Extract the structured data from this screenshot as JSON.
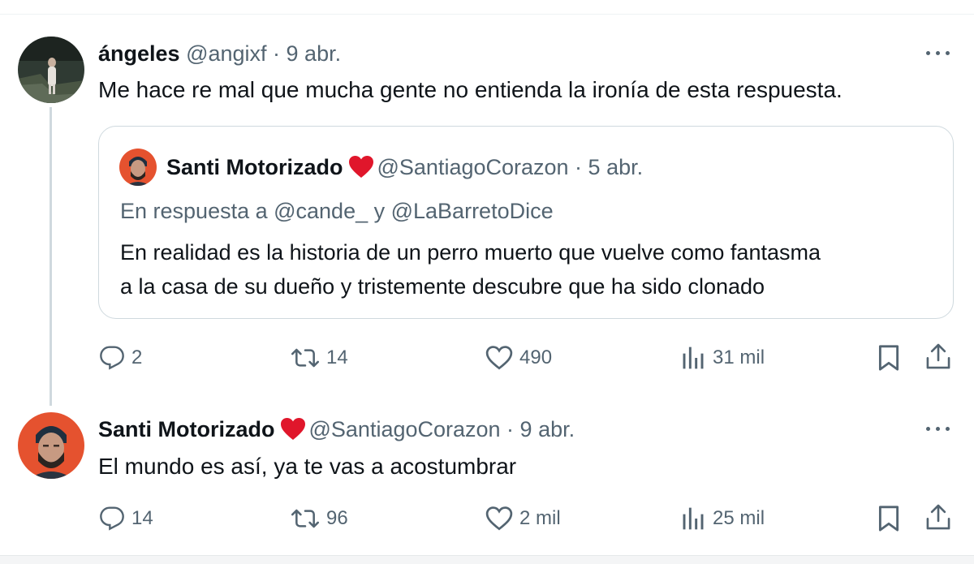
{
  "tweet1": {
    "name": "ángeles",
    "handle": "@angixf · 9 abr.",
    "text": "Me hace re mal que mucha gente no entienda la ironía de esta respuesta.",
    "quote": {
      "name": "Santi Motorizado",
      "handle": "@SantiagoCorazon · 5 abr.",
      "reply_to": "En respuesta a @cande_ y @LaBarretoDice",
      "line1": "En realidad es la historia de un perro muerto que vuelve como fantasma",
      "line2": "a la casa de su dueño y tristemente descubre que ha sido clonado"
    },
    "actions": {
      "replies": "2",
      "reposts": "14",
      "likes": "490",
      "views": "31 mil"
    }
  },
  "tweet2": {
    "name": "Santi Motorizado",
    "handle": "@SantiagoCorazon · 9 abr.",
    "text": "El mundo es así, ya te vas a acostumbrar",
    "actions": {
      "replies": "14",
      "reposts": "96",
      "likes": "2 mil",
      "views": "25 mil"
    }
  },
  "icons": {
    "reply": "speech-bubble-icon",
    "repost": "repost-arrows-icon",
    "like": "heart-outline-icon",
    "views": "bar-chart-icon",
    "bookmark": "bookmark-icon",
    "share": "share-upload-icon",
    "more": "more-dots-icon",
    "verified_heart": "red-heart-icon"
  },
  "colors": {
    "text": "#0f1419",
    "secondary": "#536471",
    "border": "#cfd9de",
    "heart": "#e0162b",
    "avatar_bg": "#e5522f"
  }
}
